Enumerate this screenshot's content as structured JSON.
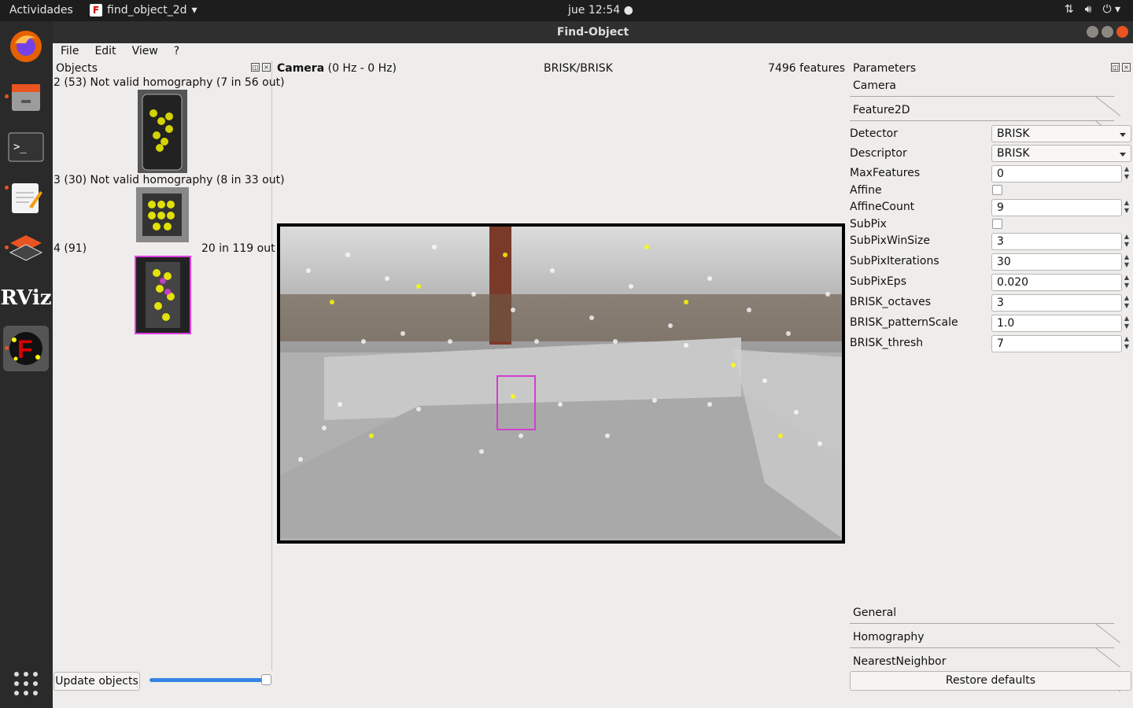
{
  "topbar": {
    "activities": "Actividades",
    "app_name": "find_object_2d",
    "clock": "jue 12:54"
  },
  "window": {
    "title": "Find-Object"
  },
  "menu": [
    "File",
    "Edit",
    "View",
    "?"
  ],
  "objects_panel": {
    "title": "Objects",
    "items": [
      {
        "label": "2 (53) Not valid homography (7 in 56 out)"
      },
      {
        "label": "3 (30) Not valid homography (8 in 33 out)"
      },
      {
        "label_left": "4 (91)",
        "label_right": "20 in 119 out"
      }
    ],
    "update_button": "Update objects"
  },
  "camera": {
    "title": "Camera",
    "rate": "(0 Hz - 0 Hz)",
    "algo": "BRISK/BRISK",
    "features": "7496 features"
  },
  "parameters": {
    "title": "Parameters",
    "sections": {
      "camera": "Camera",
      "feature2d": "Feature2D",
      "general": "General",
      "homography": "Homography",
      "nearest": "NearestNeighbor"
    },
    "detector": {
      "label": "Detector",
      "value": "BRISK"
    },
    "descriptor": {
      "label": "Descriptor",
      "value": "BRISK"
    },
    "maxfeatures": {
      "label": "MaxFeatures",
      "value": "0"
    },
    "affine": {
      "label": "Affine"
    },
    "affinecount": {
      "label": "AffineCount",
      "value": "9"
    },
    "subpix": {
      "label": "SubPix"
    },
    "subpixwinsize": {
      "label": "SubPixWinSize",
      "value": "3"
    },
    "subpixiterations": {
      "label": "SubPixIterations",
      "value": "30"
    },
    "subpixeps": {
      "label": "SubPixEps",
      "value": "0.020"
    },
    "brisk_octaves": {
      "label": "BRISK_octaves",
      "value": "3"
    },
    "brisk_patternscale": {
      "label": "BRISK_patternScale",
      "value": "1.0"
    },
    "brisk_thresh": {
      "label": "BRISK_thresh",
      "value": "7"
    },
    "restore": "Restore defaults"
  }
}
